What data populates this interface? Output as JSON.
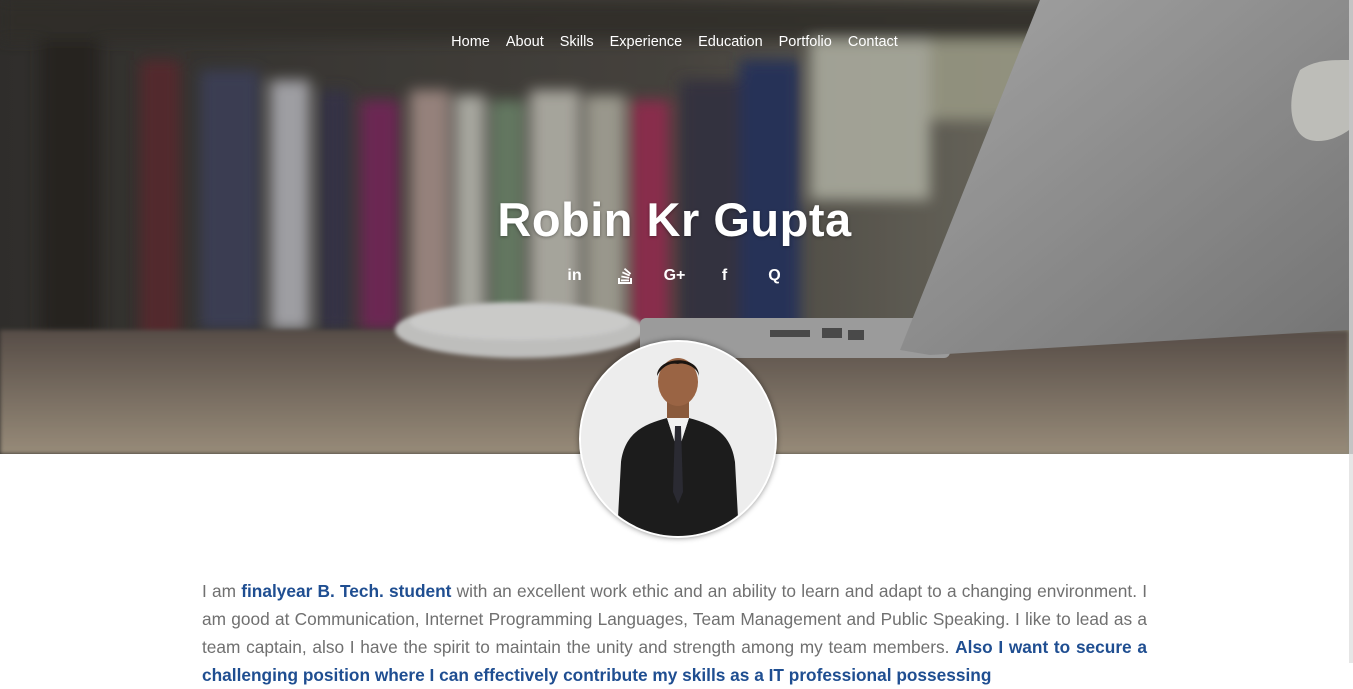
{
  "nav": {
    "items": [
      "Home",
      "About",
      "Skills",
      "Experience",
      "Education",
      "Portfolio",
      "Contact"
    ]
  },
  "hero": {
    "name": "Robin Kr Gupta"
  },
  "social": {
    "links": [
      {
        "icon": "linkedin-icon",
        "glyph": "in"
      },
      {
        "icon": "stackoverflow-icon",
        "glyph": "≡"
      },
      {
        "icon": "google-plus-icon",
        "glyph": "G+"
      },
      {
        "icon": "facebook-icon",
        "glyph": "f"
      },
      {
        "icon": "quora-icon",
        "glyph": "Q"
      }
    ]
  },
  "bio": {
    "part1": "I am ",
    "highlight1": "finalyear B. Tech. student",
    "part2": " with an excellent work ethic and an ability to learn and adapt to a changing environment. I am good at Communication, Internet Programming Languages, Team Management and Public Speaking. I like to lead as a team captain, also I have the spirit to maintain the unity and strength among my team members. ",
    "highlight2": "Also I want to secure a challenging position where I can effectively contribute my skills as a IT professional possessing"
  },
  "colors": {
    "accent": "#1f4e91",
    "body_text": "#707070"
  }
}
